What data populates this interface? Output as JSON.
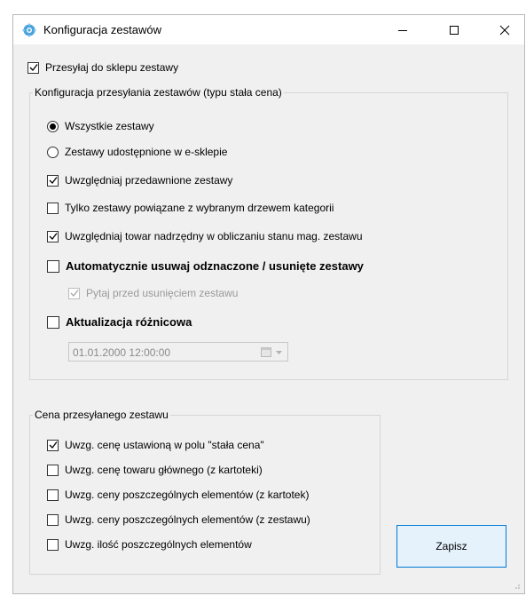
{
  "window": {
    "title": "Konfiguracja zestawów",
    "controls": {
      "minimize": "minimize-icon",
      "maximize": "maximize-icon",
      "close": "close-icon"
    }
  },
  "top_checkbox": {
    "label": "Przesyłaj do sklepu zestawy",
    "checked": true
  },
  "config_group": {
    "title": "Konfiguracja przesyłania zestawów (typu stała cena)",
    "radio_all": {
      "label": "Wszystkie zestawy",
      "selected": true
    },
    "radio_shared": {
      "label": "Zestawy udostępnione w e-sklepie",
      "selected": false
    },
    "cb_discontinued": {
      "label": "Uwzględniaj przedawnione zestawy",
      "checked": true
    },
    "cb_category": {
      "label": "Tylko zestawy powiązane z wybranym drzewem kategorii",
      "checked": false
    },
    "cb_parent": {
      "label": "Uwzględniaj towar nadrzędny w obliczaniu stanu mag. zestawu",
      "checked": true
    },
    "cb_autodelete": {
      "label": "Automatycznie usuwaj odznaczone / usunięte zestawy",
      "checked": false
    },
    "cb_ask": {
      "label": "Pytaj przed usunięciem zestawu",
      "checked": true,
      "disabled": true
    },
    "cb_diff": {
      "label": "Aktualizacja różnicowa",
      "checked": false
    },
    "date_value": "01.01.2000 12:00:00"
  },
  "price_group": {
    "title": "Cena przesyłanego zestawu",
    "items": [
      {
        "label": "Uwzg. cenę ustawioną w polu \"stała cena\"",
        "checked": true
      },
      {
        "label": "Uwzg. cenę towaru głównego (z kartoteki)",
        "checked": false
      },
      {
        "label": "Uwzg. ceny poszczególnych elementów (z kartotek)",
        "checked": false
      },
      {
        "label": "Uwzg. ceny poszczególnych elementów (z zestawu)",
        "checked": false
      },
      {
        "label": "Uwzg. ilość poszczególnych elementów",
        "checked": false
      }
    ]
  },
  "save_button": {
    "label": "Zapisz"
  },
  "colors": {
    "accent": "#0078d7",
    "window_bg": "#f0f0f0",
    "button_bg": "#e5f1fb"
  }
}
